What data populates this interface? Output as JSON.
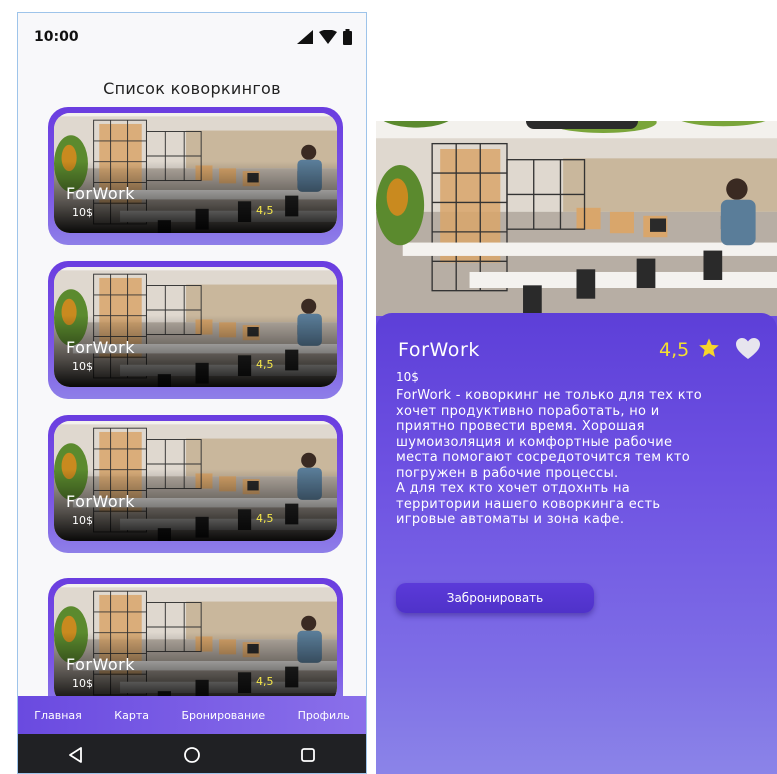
{
  "status_bar": {
    "time": "10:00",
    "icons": [
      "signal-icon",
      "wifi-icon",
      "battery-icon"
    ]
  },
  "list_screen": {
    "title": "Список коворкингов",
    "cards": [
      {
        "name": "ForWork",
        "price": "10$",
        "rating": "4,5"
      },
      {
        "name": "ForWork",
        "price": "10$",
        "rating": "4,5"
      },
      {
        "name": "ForWork",
        "price": "10$",
        "rating": "4,5"
      },
      {
        "name": "ForWork",
        "price": "10$",
        "rating": "4,5"
      }
    ],
    "bottom_nav": [
      "Главная",
      "Карта",
      "Бронирование",
      "Профиль"
    ],
    "system_nav": [
      "back-icon",
      "home-icon",
      "recents-icon"
    ]
  },
  "detail_screen": {
    "name": "ForWork",
    "rating": "4,5",
    "price": "10$",
    "description": "ForWork - коворкинг не только для тех кто\nхочет продуктивно поработать, но и\nприятно провести время. Хорошая\nшумоизоляция и комфортные рабочие\nместа помогают сосредоточится тем кто\nпогружен в рабочие процессы.\nА для тех кто хочет отдохнть на\nтерритории нашего коворкинга есть\nигровые автоматы и зона кафе.",
    "book_button": "Забронировать"
  },
  "colors": {
    "accent": "#6a3de0",
    "rating": "#f6e84a",
    "nav_bar": "#202124"
  }
}
